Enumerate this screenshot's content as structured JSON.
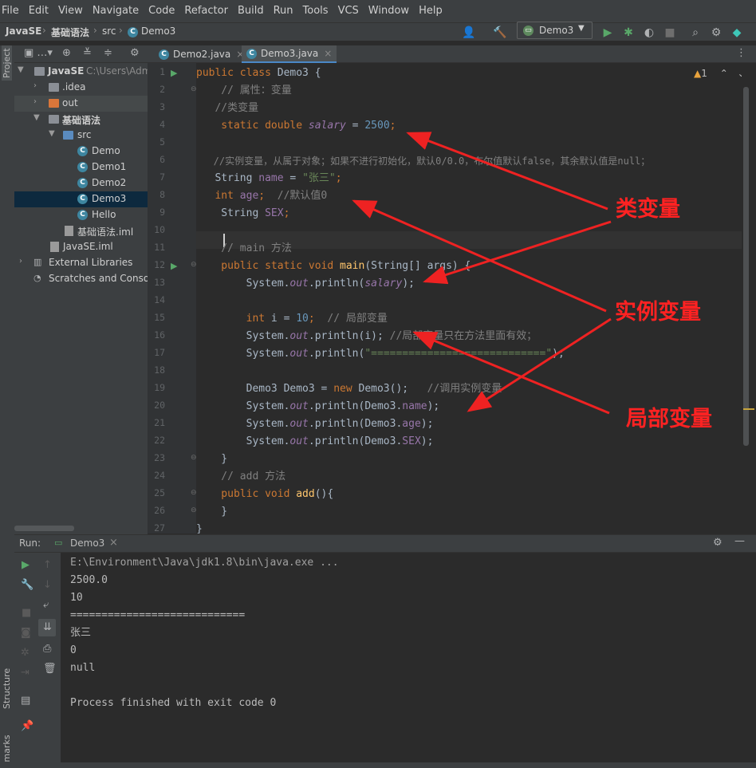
{
  "menu": [
    "File",
    "Edit",
    "View",
    "Navigate",
    "Code",
    "Refactor",
    "Build",
    "Run",
    "Tools",
    "VCS",
    "Window",
    "Help"
  ],
  "breadcrumb": {
    "project": "JavaSE",
    "folder": "基础语法",
    "src": "src",
    "file": "Demo3"
  },
  "run_config": "Demo3",
  "left_tool": {
    "project": "Project",
    "structure": "Structure",
    "bookmarks": "Bookmarks"
  },
  "project_tree": {
    "root_name": "JavaSE",
    "root_path": "C:\\Users\\Adm",
    "items": [
      ".idea",
      "out",
      "基础语法",
      "src",
      "Demo",
      "Demo1",
      "Demo2",
      "Demo3",
      "Hello",
      "基础语法.iml",
      "JavaSE.iml",
      "External Libraries",
      "Scratches and Conso"
    ]
  },
  "tabs": [
    {
      "label": "Demo2.java"
    },
    {
      "label": "Demo3.java"
    }
  ],
  "inspection": {
    "count": "1"
  },
  "line_numbers": [
    "1",
    "2",
    "3",
    "4",
    "5",
    "6",
    "7",
    "8",
    "9",
    "10",
    "11",
    "12",
    "13",
    "14",
    "15",
    "16",
    "17",
    "18",
    "19",
    "20",
    "21",
    "22",
    "23",
    "24",
    "25",
    "26",
    "27"
  ],
  "code": {
    "l1": [
      "public class ",
      "Demo3 {"
    ],
    "l2": [
      "    // 属性：变量"
    ],
    "l3": [
      "   //类变量"
    ],
    "l4": [
      "    static double ",
      "salary",
      " = ",
      "2500",
      ";"
    ],
    "l6": [
      "   //实例变量，从属于对象；如果不进行初始化，默认0/0.0，布尔值默认false，其余默认值是null；"
    ],
    "l7": [
      "   String ",
      "name",
      " = ",
      "\"张三\"",
      ";"
    ],
    "l8": [
      "   int ",
      "age",
      ";  ",
      "//默认值0"
    ],
    "l9": [
      "    String ",
      "SEX",
      ";"
    ],
    "l11": [
      "    // main 方法"
    ],
    "l12": [
      "    public static void ",
      "main",
      "(String[] args) {"
    ],
    "l13": [
      "        System.",
      "out",
      ".println(",
      "salary",
      ");"
    ],
    "l15": [
      "        int ",
      "i = ",
      "10",
      ";  ",
      "// 局部变量"
    ],
    "l16": [
      "        System.",
      "out",
      ".println(i); ",
      "//局部变量只在方法里面有效；"
    ],
    "l17": [
      "        System.",
      "out",
      ".println(",
      "\"============================\"",
      ");"
    ],
    "l19": [
      "        Demo3 Demo3 = ",
      "new ",
      "Demo3();   ",
      "//调用实例变量"
    ],
    "l20": [
      "        System.",
      "out",
      ".println(Demo3.",
      "name",
      ");"
    ],
    "l21": [
      "        System.",
      "out",
      ".println(Demo3.",
      "age",
      ");"
    ],
    "l22": [
      "        System.",
      "out",
      ".println(Demo3.",
      "SEX",
      ");"
    ],
    "l23": [
      "    }"
    ],
    "l24": [
      "    // add 方法"
    ],
    "l25": [
      "    public void ",
      "add",
      "(){"
    ],
    "l26": [
      "    }"
    ],
    "l27": [
      "}"
    ]
  },
  "annotations": {
    "class_var": "类变量",
    "instance_var": "实例变量",
    "local_var": "局部变量"
  },
  "run": {
    "label": "Run:",
    "tab": "Demo3"
  },
  "console": [
    "E:\\Environment\\Java\\jdk1.8\\bin\\java.exe ...",
    "2500.0",
    "10",
    "============================",
    "张三",
    "0",
    "null",
    "",
    "Process finished with exit code 0"
  ],
  "colors": {
    "keyword": "#cc7832",
    "comment": "#808080",
    "number": "#6897bb",
    "string": "#6a8759",
    "field": "#9876aa",
    "method": "#ffc66d",
    "annotation": "#ff2222"
  }
}
